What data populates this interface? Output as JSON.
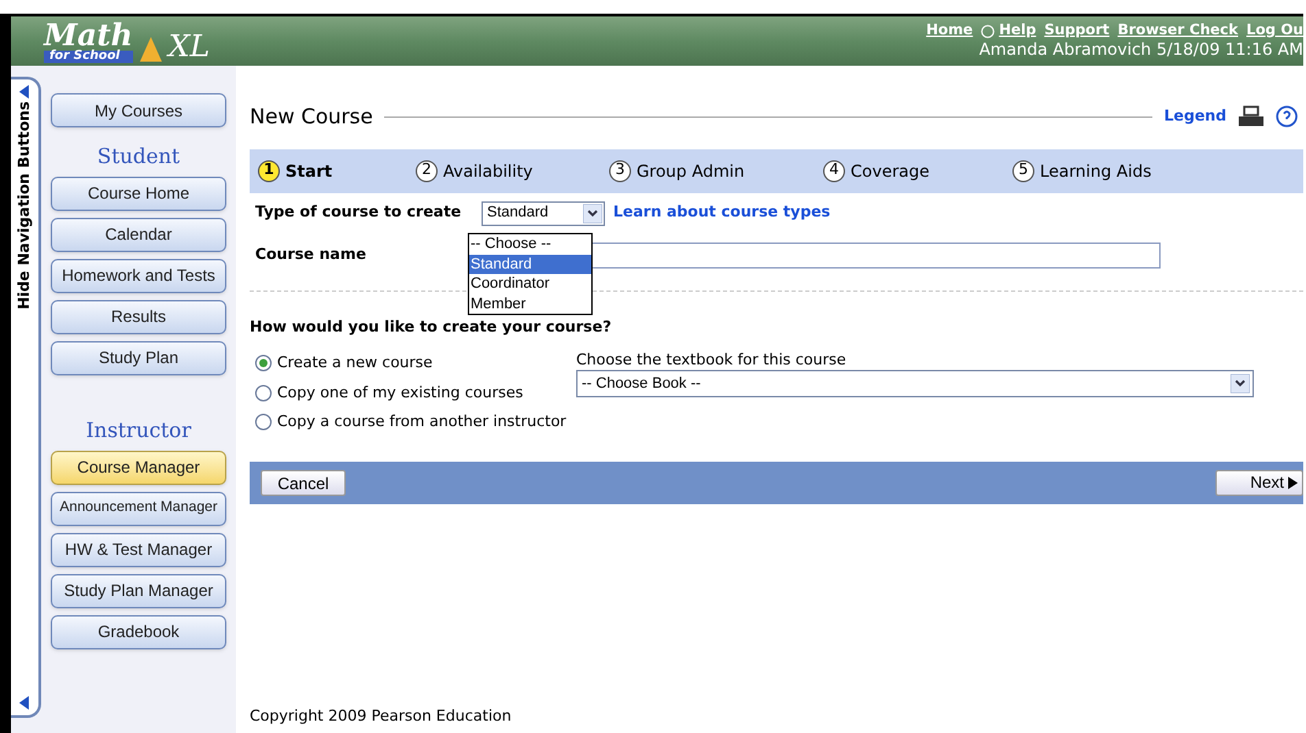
{
  "header": {
    "logo": {
      "word1": "Math",
      "word2": "XL",
      "tagline": "for School"
    },
    "links": [
      "Home",
      "Help",
      "Support",
      "Browser Check",
      "Log Ou"
    ],
    "user_line": "Amanda Abramovich 5/18/09 11:16 AM"
  },
  "sidebar": {
    "toggle_label": "Hide Navigation Buttons",
    "top_item": {
      "label": "My Courses",
      "selected": false
    },
    "sections": [
      {
        "title": "Student",
        "items": [
          {
            "label": "Course Home",
            "selected": false
          },
          {
            "label": "Calendar",
            "selected": false
          },
          {
            "label": "Homework and Tests",
            "selected": false
          },
          {
            "label": "Results",
            "selected": false
          },
          {
            "label": "Study Plan",
            "selected": false
          }
        ]
      },
      {
        "title": "Instructor",
        "items": [
          {
            "label": "Course Manager",
            "selected": true
          },
          {
            "label": "Announcement Manager",
            "selected": false
          },
          {
            "label": "HW & Test Manager",
            "selected": false
          },
          {
            "label": "Study Plan Manager",
            "selected": false
          },
          {
            "label": "Gradebook",
            "selected": false
          }
        ]
      }
    ]
  },
  "page": {
    "title": "New Course",
    "legend": "Legend",
    "steps": [
      {
        "number": "1",
        "label": "Start",
        "selected": true
      },
      {
        "number": "2",
        "label": "Availability",
        "selected": false
      },
      {
        "number": "3",
        "label": "Group Admin",
        "selected": false
      },
      {
        "number": "4",
        "label": "Coverage",
        "selected": false
      },
      {
        "number": "5",
        "label": "Learning Aids",
        "selected": false
      }
    ],
    "course_type": {
      "label": "Type of course to create",
      "value": "Standard",
      "expanded": true,
      "link": "Learn about course types",
      "options": [
        {
          "label": "-- Choose --",
          "selected": false
        },
        {
          "label": "Standard",
          "selected": true
        },
        {
          "label": "Coordinator",
          "selected": false
        },
        {
          "label": "Member",
          "selected": false
        }
      ]
    },
    "course_name": {
      "label": "Course name"
    },
    "question": "How would you like to create your course?",
    "methods": [
      {
        "label": "Create a new course",
        "selected": true
      },
      {
        "label": "Copy one of my existing courses",
        "selected": false
      },
      {
        "label": "Copy a course from another instructor",
        "selected": false
      }
    ],
    "textbook": {
      "label": "Choose the textbook for this course",
      "value": "-- Choose Book --"
    },
    "buttons": {
      "cancel": "Cancel",
      "next": "Next"
    },
    "copyright": "Copyright 2009 Pearson Education"
  }
}
